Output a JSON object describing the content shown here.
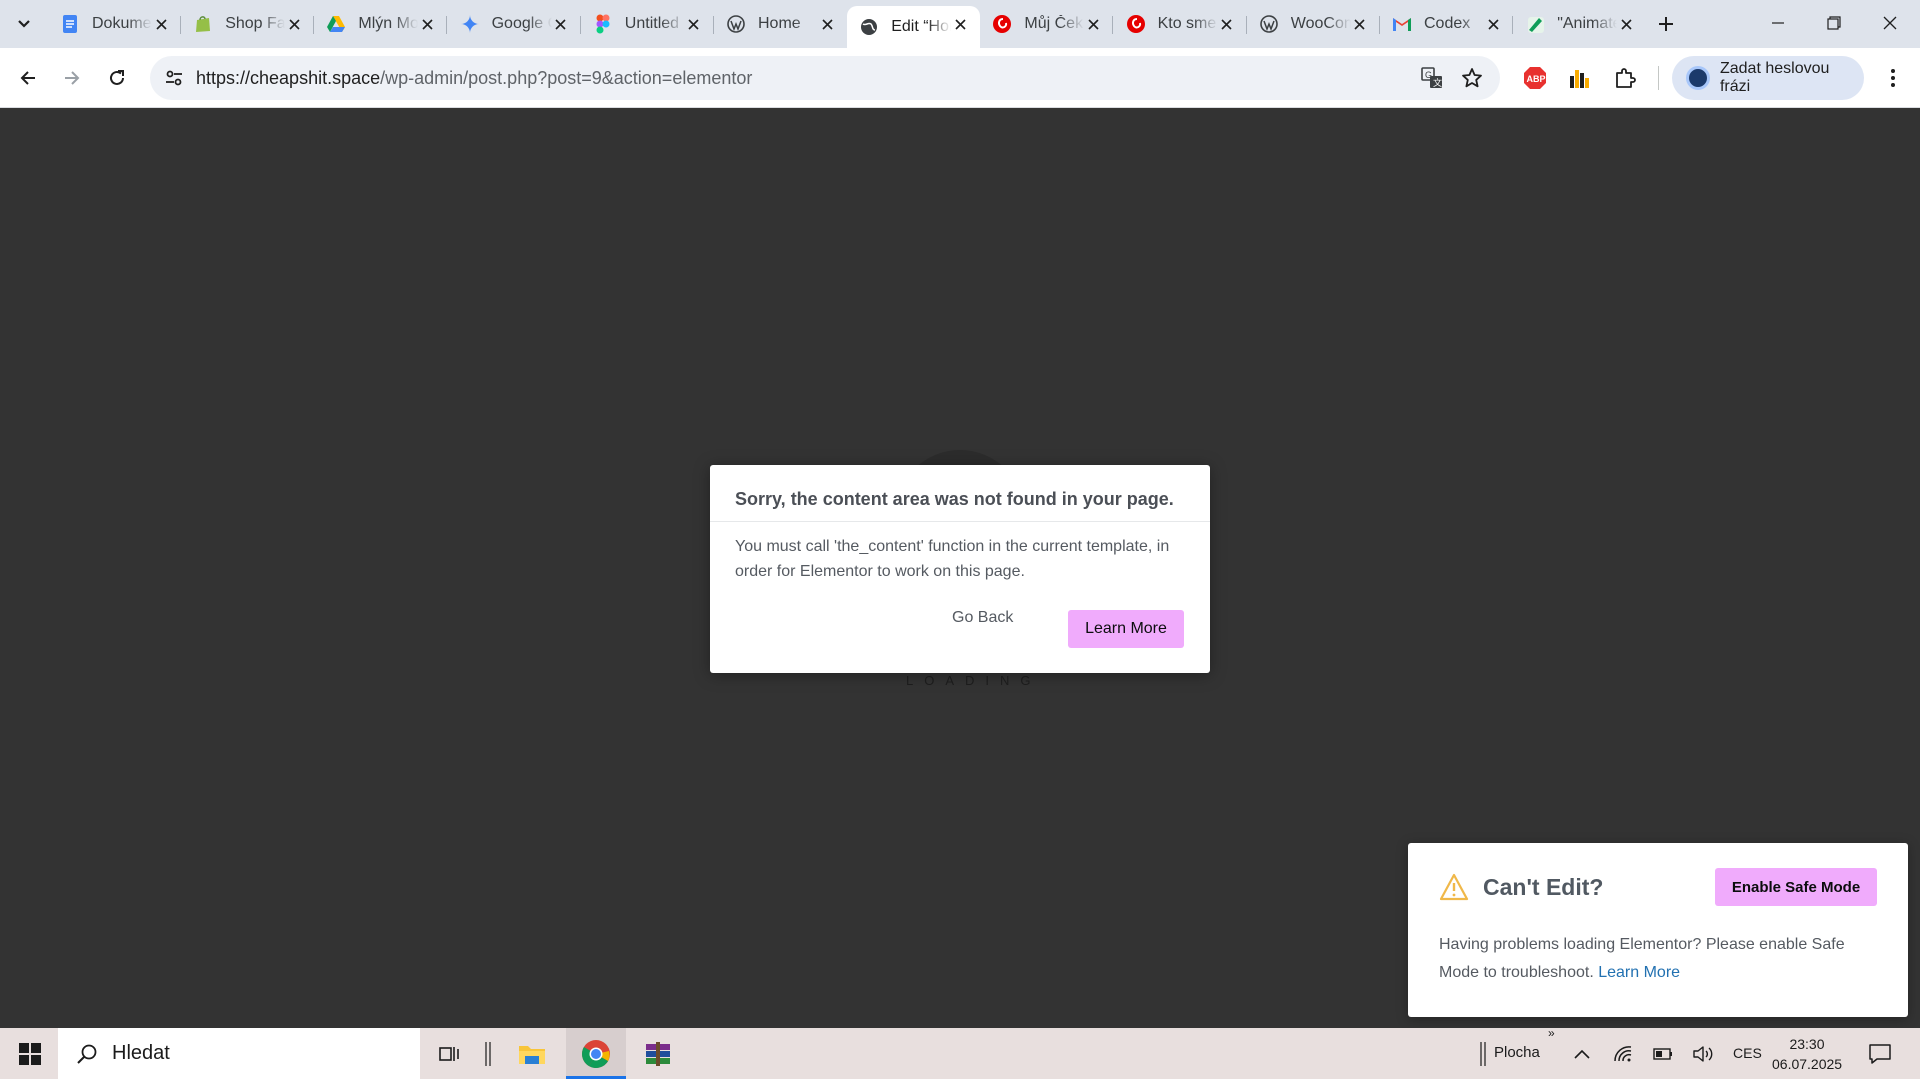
{
  "browser": {
    "tabs": [
      {
        "label": "Dokumenty",
        "icon": "google-docs-icon",
        "color": "#4285f4"
      },
      {
        "label": "Shop Fake",
        "icon": "shopify-icon",
        "color": "#95bf47"
      },
      {
        "label": "Mlýn Moravia",
        "icon": "google-drive-icon",
        "color": "#0f9d58"
      },
      {
        "label": "Google Gemini",
        "icon": "gemini-icon",
        "color": "#4285f4"
      },
      {
        "label": "Untitled",
        "icon": "figma-icon",
        "color": "#f24e1e"
      },
      {
        "label": "Home",
        "icon": "wordpress-icon",
        "color": "#3c4043"
      },
      {
        "label": "Edit “Home”",
        "icon": "globe-icon",
        "color": "#3c4043",
        "active": true
      },
      {
        "label": "Můj Čeká",
        "icon": "vodafone-icon",
        "color": "#e60000"
      },
      {
        "label": "Kto sme",
        "icon": "vodafone-icon",
        "color": "#e60000"
      },
      {
        "label": "WooCommerce",
        "icon": "wordpress-icon",
        "color": "#3c4043"
      },
      {
        "label": "Codex",
        "icon": "gmail-icon",
        "color": "#ea4335"
      },
      {
        "label": "\"Animate",
        "icon": "pen-icon",
        "color": "#0f9d58"
      }
    ],
    "url_host": "https://cheapshit.space",
    "url_path": "/wp-admin/post.php?post=9&action=elementor",
    "passkey_label": "Zadat heslovou frázi"
  },
  "page": {
    "loading_text": "LOADING"
  },
  "dialog": {
    "title": "Sorry, the content area was not found in your page.",
    "message": "You must call 'the_content' function in the current template, in order for Elementor to work on this page.",
    "go_back": "Go Back",
    "learn_more": "Learn More"
  },
  "notice": {
    "title": "Can't Edit?",
    "button": "Enable Safe Mode",
    "text": "Having problems loading Elementor? Please enable Safe Mode to troubleshoot.",
    "link": "Learn More"
  },
  "taskbar": {
    "search_placeholder": "Hledat",
    "desktop_label": "Plocha",
    "language": "CES",
    "time": "23:30",
    "date": "06.07.2025"
  },
  "colors": {
    "accent_pink": "#f0abfc",
    "link_blue": "#2271b1",
    "warning": "#f0b849",
    "page_bg": "#333333"
  }
}
